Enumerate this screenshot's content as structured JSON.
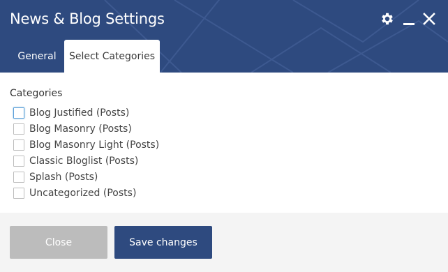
{
  "window": {
    "title": "News & Blog Settings",
    "header_color": "#2e4a7f",
    "icons": [
      "gear-icon",
      "minimize-icon",
      "close-icon"
    ]
  },
  "tabs": [
    {
      "label": "General",
      "active": false
    },
    {
      "label": "Select Categories",
      "active": true
    }
  ],
  "categories": {
    "heading": "Categories",
    "items": [
      {
        "label": "Blog Justified (Posts)",
        "checked": false,
        "focused": true
      },
      {
        "label": "Blog Masonry (Posts)",
        "checked": false
      },
      {
        "label": "Blog Masonry Light (Posts)",
        "checked": false
      },
      {
        "label": "Classic Bloglist (Posts)",
        "checked": false
      },
      {
        "label": "Splash (Posts)",
        "checked": false
      },
      {
        "label": "Uncategorized (Posts)",
        "checked": false
      }
    ]
  },
  "footer": {
    "close_label": "Close",
    "save_label": "Save changes",
    "close_color": "#bcbcbc",
    "save_color": "#2e4a7f"
  }
}
